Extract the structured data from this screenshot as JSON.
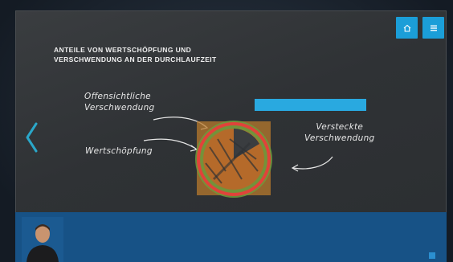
{
  "slide": {
    "title_line1": "ANTEILE VON WERTSCHÖPFUNG UND",
    "title_line2": "VERSCHWENDUNG AN DER DURCHLAUFZEIT"
  },
  "labels": {
    "obvious_waste_line1": "Offensichtliche",
    "obvious_waste_line2": "Verschwendung",
    "value_add": "Wertschöpfung",
    "hidden_waste_line1": "Versteckte",
    "hidden_waste_line2": "Verschwendung"
  },
  "cta_button_label": "",
  "info": {
    "lines": [
      "",
      "",
      "",
      "",
      "",
      "",
      ""
    ]
  },
  "icons": {
    "home": "home-icon",
    "menu": "menu-icon",
    "prev": "chevron-left-icon"
  },
  "colors": {
    "accent": "#1b9ed8",
    "chalkboard": "#2f3235",
    "infobar": "#175286"
  }
}
